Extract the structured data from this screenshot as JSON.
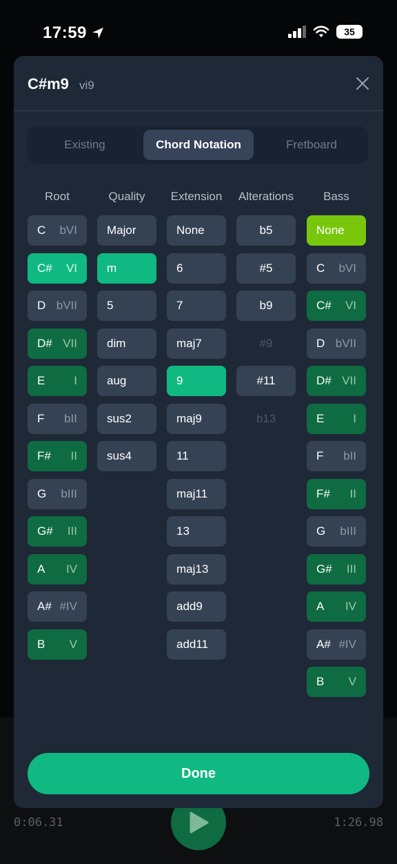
{
  "status_bar": {
    "time": "17:59",
    "battery": "35"
  },
  "background": {
    "elapsed": "0:06.31",
    "total": "1:26.98"
  },
  "modal": {
    "title": "C#m9",
    "degree": "vi9",
    "tabs": [
      "Existing",
      "Chord Notation",
      "Fretboard"
    ],
    "active_tab": "Chord Notation",
    "columns": [
      "Root",
      "Quality",
      "Extension",
      "Alterations",
      "Bass"
    ],
    "root": [
      {
        "note": "C",
        "deg": "bVI"
      },
      {
        "note": "C#",
        "deg": "VI"
      },
      {
        "note": "D",
        "deg": "bVII"
      },
      {
        "note": "D#",
        "deg": "VII"
      },
      {
        "note": "E",
        "deg": "I"
      },
      {
        "note": "F",
        "deg": "bII"
      },
      {
        "note": "F#",
        "deg": "II"
      },
      {
        "note": "G",
        "deg": "bIII"
      },
      {
        "note": "G#",
        "deg": "III"
      },
      {
        "note": "A",
        "deg": "IV"
      },
      {
        "note": "A#",
        "deg": "#IV"
      },
      {
        "note": "B",
        "deg": "V"
      }
    ],
    "quality": [
      "Major",
      "m",
      "5",
      "dim",
      "aug",
      "sus2",
      "sus4"
    ],
    "extension": [
      "None",
      "6",
      "7",
      "maj7",
      "9",
      "maj9",
      "11",
      "maj11",
      "13",
      "maj13",
      "add9",
      "add11"
    ],
    "alterations": [
      "b5",
      "#5",
      "b9",
      "#9",
      "#11",
      "b13"
    ],
    "bass_none": "None",
    "bass": [
      {
        "note": "C",
        "deg": "bVI"
      },
      {
        "note": "C#",
        "deg": "VI"
      },
      {
        "note": "D",
        "deg": "bVII"
      },
      {
        "note": "D#",
        "deg": "VII"
      },
      {
        "note": "E",
        "deg": "I"
      },
      {
        "note": "F",
        "deg": "bII"
      },
      {
        "note": "F#",
        "deg": "II"
      },
      {
        "note": "G",
        "deg": "bIII"
      },
      {
        "note": "G#",
        "deg": "III"
      },
      {
        "note": "A",
        "deg": "IV"
      },
      {
        "note": "A#",
        "deg": "#IV"
      },
      {
        "note": "B",
        "deg": "V"
      }
    ],
    "done_label": "Done"
  },
  "colors": {
    "selected": "#10b981",
    "in_key": "#0f6b42",
    "bass_none_selected": "#79c70d",
    "neutral": "#354254",
    "modal_bg": "#1e2836"
  }
}
